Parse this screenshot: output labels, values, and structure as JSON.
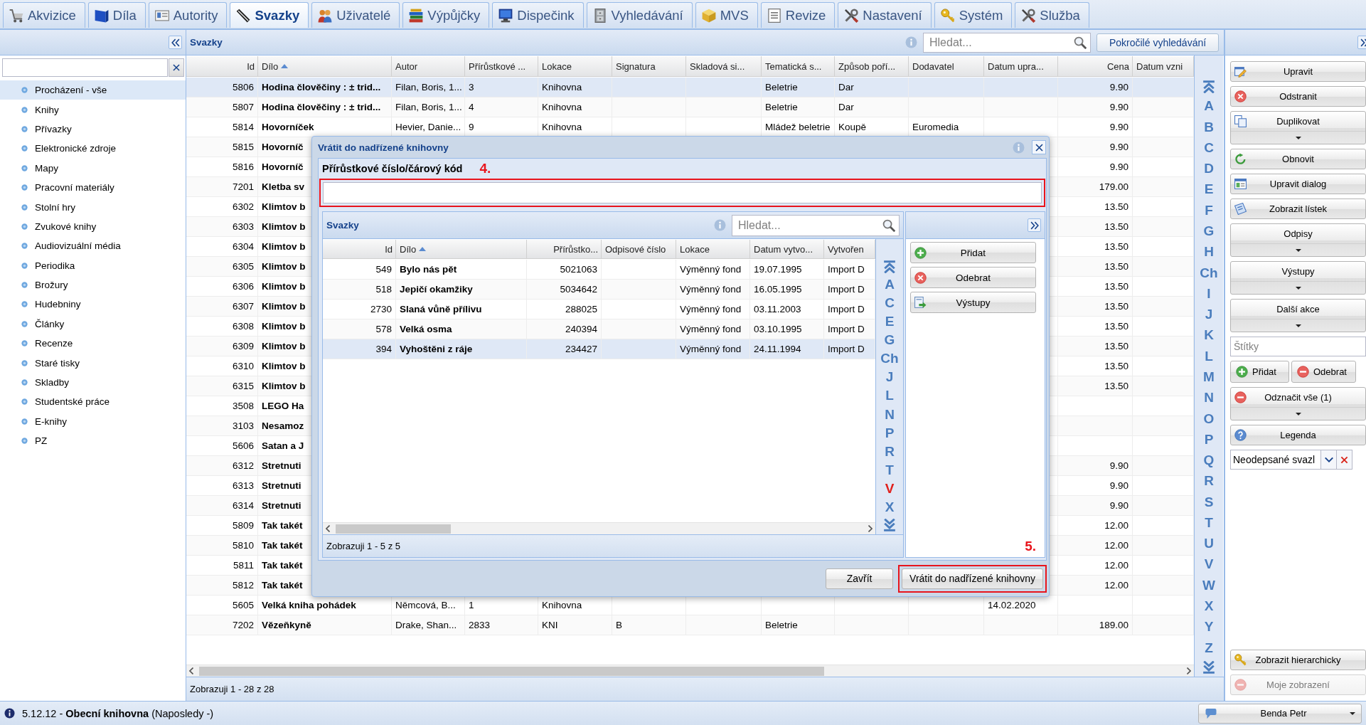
{
  "tabs": [
    {
      "label": "Akvizice",
      "selected": false
    },
    {
      "label": "Díla",
      "selected": false
    },
    {
      "label": "Autority",
      "selected": false
    },
    {
      "label": "Svazky",
      "selected": true
    },
    {
      "label": "Uživatelé",
      "selected": false
    },
    {
      "label": "Výpůjčky",
      "selected": false
    },
    {
      "label": "Dispečink",
      "selected": false
    },
    {
      "label": "Vyhledávání",
      "selected": false
    },
    {
      "label": "MVS",
      "selected": false
    },
    {
      "label": "Revize",
      "selected": false
    },
    {
      "label": "Nastavení",
      "selected": false
    },
    {
      "label": "Systém",
      "selected": false
    },
    {
      "label": "Služba",
      "selected": false
    }
  ],
  "sidebar": {
    "items": [
      {
        "label": "Procházení - vše",
        "selected": true
      },
      {
        "label": "Knihy",
        "selected": false
      },
      {
        "label": "Přívazky",
        "selected": false
      },
      {
        "label": "Elektronické zdroje",
        "selected": false
      },
      {
        "label": "Mapy",
        "selected": false
      },
      {
        "label": "Pracovní materiály",
        "selected": false
      },
      {
        "label": "Stolní hry",
        "selected": false
      },
      {
        "label": "Zvukové knihy",
        "selected": false
      },
      {
        "label": "Audiovizuální média",
        "selected": false
      },
      {
        "label": "Periodika",
        "selected": false
      },
      {
        "label": "Brožury",
        "selected": false
      },
      {
        "label": "Hudebniny",
        "selected": false
      },
      {
        "label": "Články",
        "selected": false
      },
      {
        "label": "Recenze",
        "selected": false
      },
      {
        "label": "Staré tisky",
        "selected": false
      },
      {
        "label": "Skladby",
        "selected": false
      },
      {
        "label": "Studentské práce",
        "selected": false
      },
      {
        "label": "E-knihy",
        "selected": false
      },
      {
        "label": "PZ",
        "selected": false
      }
    ]
  },
  "main_panel": {
    "title": "Svazky",
    "search": {
      "placeholder": "Hledat..."
    },
    "advanced_search": "Pokročilé vyhledávání",
    "table": {
      "columns": [
        {
          "label": "Id",
          "kind": "number",
          "sorted": false
        },
        {
          "label": "Dílo",
          "kind": "title",
          "sorted": true
        },
        {
          "label": "Autor",
          "kind": "text",
          "sorted": false
        },
        {
          "label": "Přírůstkové ...",
          "kind": "text",
          "sorted": false
        },
        {
          "label": "Lokace",
          "kind": "text",
          "sorted": false
        },
        {
          "label": "Signatura",
          "kind": "text",
          "sorted": false
        },
        {
          "label": "Skladová si...",
          "kind": "text",
          "sorted": false
        },
        {
          "label": "Tematická s...",
          "kind": "text",
          "sorted": false
        },
        {
          "label": "Způsob poří...",
          "kind": "text",
          "sorted": false
        },
        {
          "label": "Dodavatel",
          "kind": "text",
          "sorted": false
        },
        {
          "label": "Datum upra...",
          "kind": "text",
          "sorted": false
        },
        {
          "label": "Cena",
          "kind": "number",
          "sorted": false
        },
        {
          "label": "Datum vzni",
          "kind": "text",
          "sorted": false
        }
      ],
      "rows": [
        {
          "id": "5806",
          "work": "Hodina člověčiny : ± trid...",
          "author": "Filan, Boris, 1...",
          "accession_number": "3",
          "location": "Knihovna",
          "subject_group": "Beletrie",
          "acquisition": "Dar",
          "price": "9.90",
          "selected": true
        },
        {
          "id": "5807",
          "work": "Hodina člověčiny : ± trid...",
          "author": "Filan, Boris, 1...",
          "accession_number": "4",
          "location": "Knihovna",
          "subject_group": "Beletrie",
          "acquisition": "Dar",
          "price": "9.90",
          "selected": false
        },
        {
          "id": "5814",
          "work": "Hovorníček",
          "author": "Hevier, Danie...",
          "accession_number": "9",
          "location": "Knihovna",
          "subject_group": "Mládež beletrie",
          "acquisition": "Koupě",
          "supplier": "Euromedia",
          "price": "9.90",
          "selected": false
        },
        {
          "id": "5815",
          "work": "Hovorníč",
          "price": "9.90",
          "selected": false
        },
        {
          "id": "5816",
          "work": "Hovorníč",
          "price": "9.90",
          "selected": false
        },
        {
          "id": "7201",
          "work": "Kletba sv",
          "price": "179.00",
          "selected": false
        },
        {
          "id": "6302",
          "work": "Klimtov b",
          "price": "13.50",
          "selected": false
        },
        {
          "id": "6303",
          "work": "Klimtov b",
          "price": "13.50",
          "selected": false
        },
        {
          "id": "6304",
          "work": "Klimtov b",
          "price": "13.50",
          "selected": false
        },
        {
          "id": "6305",
          "work": "Klimtov b",
          "price": "13.50",
          "selected": false
        },
        {
          "id": "6306",
          "work": "Klimtov b",
          "price": "13.50",
          "selected": false
        },
        {
          "id": "6307",
          "work": "Klimtov b",
          "price": "13.50",
          "selected": false
        },
        {
          "id": "6308",
          "work": "Klimtov b",
          "price": "13.50",
          "selected": false
        },
        {
          "id": "6309",
          "work": "Klimtov b",
          "price": "13.50",
          "selected": false
        },
        {
          "id": "6310",
          "work": "Klimtov b",
          "price": "13.50",
          "selected": false
        },
        {
          "id": "6315",
          "work": "Klimtov b",
          "price": "13.50",
          "selected": false
        },
        {
          "id": "3508",
          "work": "LEGO Ha",
          "selected": false
        },
        {
          "id": "3103",
          "work": "Nesamoz",
          "selected": false
        },
        {
          "id": "5606",
          "work": "Satan a J",
          "selected": false
        },
        {
          "id": "6312",
          "work": "Stretnuti",
          "price": "9.90",
          "selected": false
        },
        {
          "id": "6313",
          "work": "Stretnuti",
          "price": "9.90",
          "selected": false
        },
        {
          "id": "6314",
          "work": "Stretnuti",
          "price": "9.90",
          "selected": false
        },
        {
          "id": "5809",
          "work": "Tak takét",
          "price": "12.00",
          "selected": false
        },
        {
          "id": "5810",
          "work": "Tak takét",
          "price": "12.00",
          "selected": false
        },
        {
          "id": "5811",
          "work": "Tak takét",
          "price": "12.00",
          "selected": false
        },
        {
          "id": "5812",
          "work": "Tak takét",
          "price": "12.00",
          "selected": false
        },
        {
          "id": "5605",
          "work": "Velká kniha pohádek",
          "author": "Němcová, B...",
          "accession_number": "1",
          "location": "Knihovna",
          "modified": "14.02.2020",
          "selected": false
        },
        {
          "id": "7202",
          "work": "Vězeňkyně",
          "author": "Drake, Shan...",
          "accession_number": "2833",
          "location": "KNI",
          "call_number": "B",
          "subject_group": "Beletrie",
          "price": "189.00",
          "selected": false
        }
      ]
    },
    "alphabet": [
      {
        "letter": "A",
        "selected": false
      },
      {
        "letter": "B",
        "selected": false
      },
      {
        "letter": "C",
        "selected": false
      },
      {
        "letter": "D",
        "selected": false
      },
      {
        "letter": "E",
        "selected": false
      },
      {
        "letter": "F",
        "selected": false
      },
      {
        "letter": "G",
        "selected": false
      },
      {
        "letter": "H",
        "selected": false
      },
      {
        "letter": "Ch",
        "selected": false
      },
      {
        "letter": "I",
        "selected": false
      },
      {
        "letter": "J",
        "selected": false
      },
      {
        "letter": "K",
        "selected": false
      },
      {
        "letter": "L",
        "selected": false
      },
      {
        "letter": "M",
        "selected": false
      },
      {
        "letter": "N",
        "selected": false
      },
      {
        "letter": "O",
        "selected": false
      },
      {
        "letter": "P",
        "selected": false
      },
      {
        "letter": "Q",
        "selected": false
      },
      {
        "letter": "R",
        "selected": false
      },
      {
        "letter": "S",
        "selected": false
      },
      {
        "letter": "T",
        "selected": false
      },
      {
        "letter": "U",
        "selected": false
      },
      {
        "letter": "V",
        "selected": false
      },
      {
        "letter": "W",
        "selected": false
      },
      {
        "letter": "X",
        "selected": false
      },
      {
        "letter": "Y",
        "selected": false
      },
      {
        "letter": "Z",
        "selected": false
      }
    ],
    "footer": "Zobrazuji 1 - 28 z 28"
  },
  "actions_panel": {
    "items": [
      {
        "kind": "button",
        "label": "Upravit",
        "disabled": false
      },
      {
        "kind": "button",
        "label": "Odstranit",
        "disabled": false
      },
      {
        "kind": "menu_button",
        "label": "Duplikovat",
        "disabled": false
      },
      {
        "kind": "button",
        "label": "Obnovit",
        "disabled": false
      },
      {
        "kind": "button",
        "label": "Upravit dialog",
        "disabled": false
      },
      {
        "kind": "button",
        "label": "Zobrazit lístek",
        "disabled": false
      },
      {
        "kind": "menu_button",
        "label": "Odpisy",
        "disabled": false
      },
      {
        "kind": "menu_button",
        "label": "Výstupy",
        "disabled": false
      },
      {
        "kind": "menu_button",
        "label": "Další akce",
        "disabled": false
      },
      {
        "kind": "field",
        "placeholder": "Štítky",
        "disabled": false
      },
      {
        "kind": "button_pair",
        "buttons": [
          {
            "label": "Přidat",
            "disabled": false
          },
          {
            "label": "Odebrat",
            "disabled": false
          }
        ]
      },
      {
        "kind": "menu_button",
        "label": "Odznačit vše (1)",
        "disabled": false
      },
      {
        "kind": "button",
        "label": "Legenda",
        "disabled": false
      },
      {
        "kind": "combo",
        "value": "Neodepsané svazl",
        "disabled": false
      }
    ],
    "bottom_items": [
      {
        "kind": "button",
        "label": "Zobrazit hierarchicky",
        "disabled": false
      },
      {
        "kind": "button",
        "label": "Moje zobrazení",
        "disabled": true
      }
    ]
  },
  "dialog": {
    "title": "Vrátit do nadřízené knihovny",
    "field": {
      "label": "Přírůstkové číslo/čárový kód",
      "annotation": "4."
    },
    "grid": {
      "title": "Svazky",
      "search": {
        "placeholder": "Hledat..."
      },
      "columns": [
        {
          "label": "Id",
          "kind": "number",
          "sorted": false
        },
        {
          "label": "Dílo",
          "kind": "title",
          "sorted": true
        },
        {
          "label": "Přírůstko...",
          "kind": "number",
          "sorted": false
        },
        {
          "label": "Odpisové číslo",
          "kind": "text",
          "sorted": false
        },
        {
          "label": "Lokace",
          "kind": "text",
          "sorted": false
        },
        {
          "label": "Datum vytvo...",
          "kind": "text",
          "sorted": false
        },
        {
          "label": "Vytvořen",
          "kind": "text",
          "sorted": false
        }
      ],
      "rows": [
        {
          "id": "549",
          "work": "Bylo nás pět",
          "accession_number": "5021063",
          "location": "Výměnný fond",
          "created_date": "19.07.1995",
          "created_by": "Import D",
          "selected": false
        },
        {
          "id": "518",
          "work": "Jepičí okamžiky",
          "accession_number": "5034642",
          "location": "Výměnný fond",
          "created_date": "16.05.1995",
          "created_by": "Import D",
          "selected": false
        },
        {
          "id": "2730",
          "work": "Slaná vůně přílivu",
          "accession_number": "288025",
          "location": "Výměnný fond",
          "created_date": "03.11.2003",
          "created_by": "Import D",
          "selected": false
        },
        {
          "id": "578",
          "work": "Velká osma",
          "accession_number": "240394",
          "location": "Výměnný fond",
          "created_date": "03.10.1995",
          "created_by": "Import D",
          "selected": false
        },
        {
          "id": "394",
          "work": "Vyhoštěni z ráje",
          "accession_number": "234427",
          "location": "Výměnný fond",
          "created_date": "24.11.1994",
          "created_by": "Import D",
          "selected": true
        }
      ],
      "alphabet": [
        {
          "letter": "A",
          "selected": false
        },
        {
          "letter": "C",
          "selected": false
        },
        {
          "letter": "E",
          "selected": false
        },
        {
          "letter": "G",
          "selected": false
        },
        {
          "letter": "Ch",
          "selected": false
        },
        {
          "letter": "J",
          "selected": false
        },
        {
          "letter": "L",
          "selected": false
        },
        {
          "letter": "N",
          "selected": false
        },
        {
          "letter": "P",
          "selected": false
        },
        {
          "letter": "R",
          "selected": false
        },
        {
          "letter": "T",
          "selected": false
        },
        {
          "letter": "V",
          "selected": true
        },
        {
          "letter": "X",
          "selected": false
        }
      ],
      "footer": "Zobrazuji 1 - 5 z 5"
    },
    "side_buttons": [
      "Přidat",
      "Odebrat",
      "Výstupy"
    ],
    "buttons": [
      {
        "label": "Zavřít"
      },
      {
        "label": "Vrátit do nadřízené knihovny",
        "annotation": "5."
      }
    ]
  },
  "status_bar": {
    "text": "5.12.12 - **Obecní knihovna** (Naposledy -)",
    "user": "Benda Petr"
  }
}
